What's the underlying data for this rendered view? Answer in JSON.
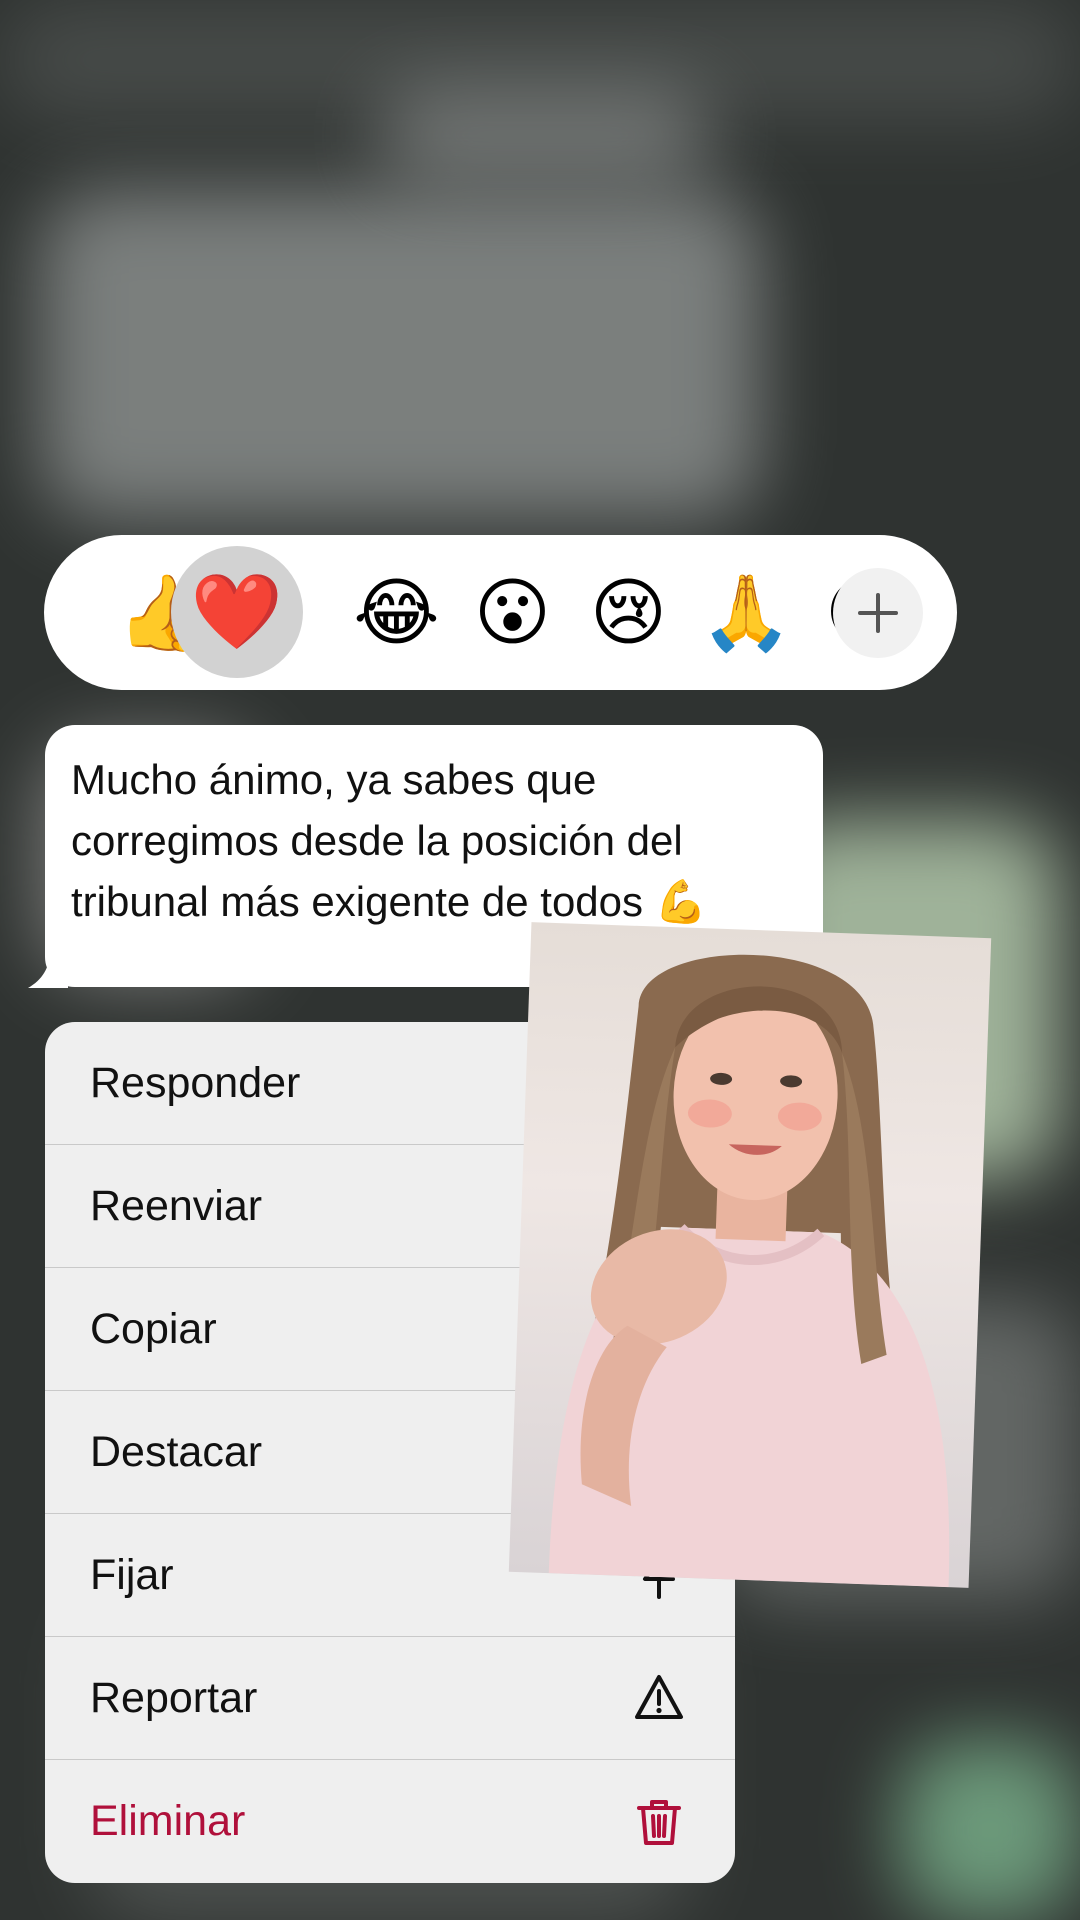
{
  "reactions": {
    "items": [
      {
        "emoji": "👍",
        "name": "thumbs-up"
      },
      {
        "emoji": "❤️",
        "name": "heart",
        "selected": true
      },
      {
        "emoji": "😂",
        "name": "laughing"
      },
      {
        "emoji": "😮",
        "name": "surprised"
      },
      {
        "emoji": "😢",
        "name": "crying"
      },
      {
        "emoji": "🙏",
        "name": "praying"
      },
      {
        "emoji": "😏",
        "name": "smirk"
      }
    ],
    "more_label": "+"
  },
  "message": {
    "text": "Mucho ánimo, ya sabes que corregimos desde la posición del tribunal más exigente de todos 💪"
  },
  "menu": {
    "items": [
      {
        "label": "Responder",
        "icon": "reply-icon"
      },
      {
        "label": "Reenviar",
        "icon": "forward-icon"
      },
      {
        "label": "Copiar",
        "icon": "copy-icon"
      },
      {
        "label": "Destacar",
        "icon": "star-icon"
      },
      {
        "label": "Fijar",
        "icon": "pin-icon"
      },
      {
        "label": "Reportar",
        "icon": "warning-icon"
      },
      {
        "label": "Eliminar",
        "icon": "trash-icon",
        "destructive": true
      }
    ]
  },
  "colors": {
    "destructive": "#b0103b",
    "menu_background": "#efefef",
    "bubble_background": "#ffffff"
  }
}
